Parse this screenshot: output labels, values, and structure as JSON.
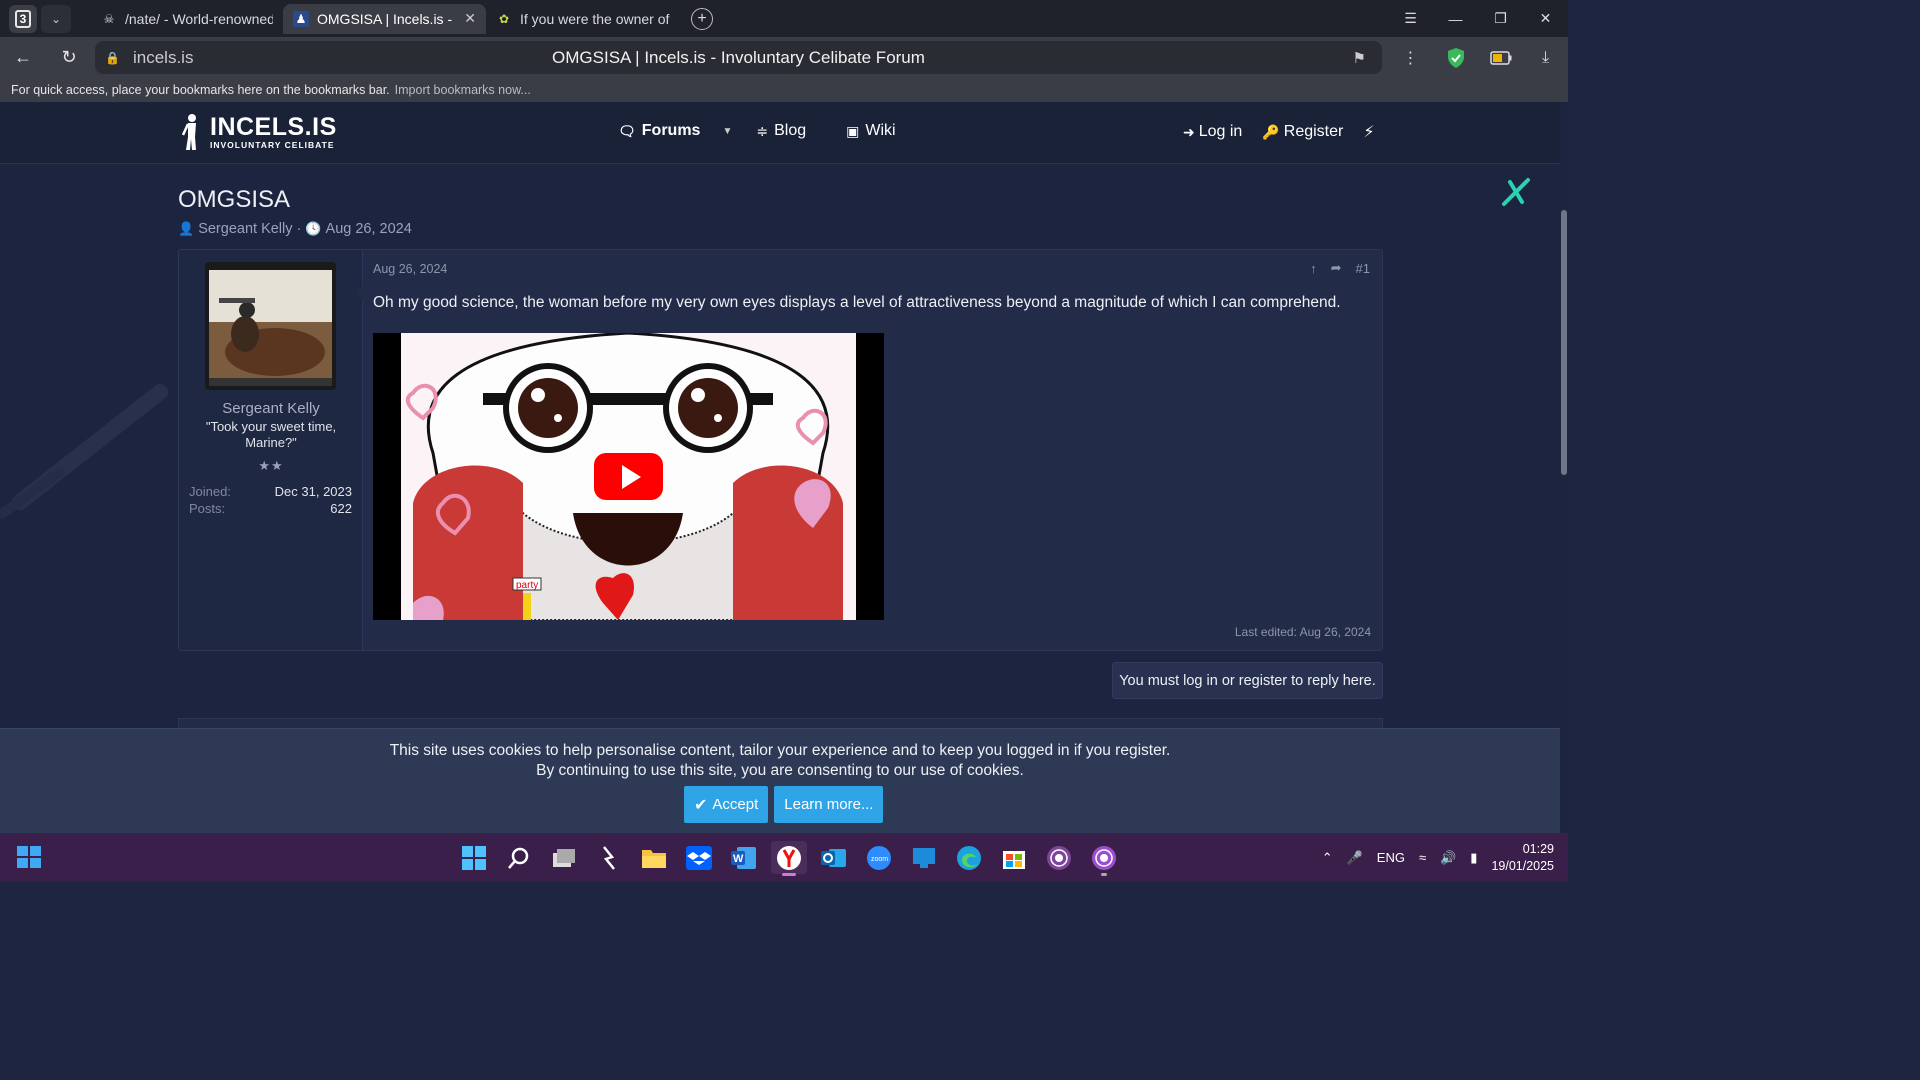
{
  "browser": {
    "tab_count": "3",
    "tabs": [
      {
        "title": "/nate/ - World-renowned C",
        "active": false
      },
      {
        "title": "OMGSISA | Incels.is - Inv",
        "active": true
      },
      {
        "title": "If you were the owner of th",
        "active": false
      }
    ],
    "url_domain": "incels.is",
    "page_title": "OMGSISA | Incels.is - Involuntary Celibate Forum",
    "bookmarks_hint": "For quick access, place your bookmarks here on the bookmarks bar.",
    "bookmarks_import": "Import bookmarks now..."
  },
  "site": {
    "logo_main": "INCELS.IS",
    "logo_sub": "INVOLUNTARY CELIBATE",
    "nav": {
      "forums": "Forums",
      "blog": "Blog",
      "wiki": "Wiki"
    },
    "auth": {
      "login": "Log in",
      "register": "Register"
    }
  },
  "thread": {
    "title": "OMGSISA",
    "author": "Sergeant Kelly",
    "date": "Aug 26, 2024"
  },
  "post": {
    "date": "Aug 26, 2024",
    "number": "#1",
    "text": "Oh my good science, the woman before my very own eyes displays a level of attractiveness beyond a magnitude of which I can comprehend.",
    "last_edited": "Last edited: Aug 26, 2024",
    "video_sticker": "party",
    "user": {
      "name": "Sergeant Kelly",
      "title": "\"Took your sweet time, Marine?\"",
      "stars": "★★",
      "joined_label": "Joined:",
      "joined_value": "Dec 31, 2023",
      "posts_label": "Posts:",
      "posts_value": "622"
    }
  },
  "reply_notice": "You must log in or register to reply here.",
  "cookie": {
    "line1": "This site uses cookies to help personalise content, tailor your experience and to keep you logged in if you register.",
    "line2": "By continuing to use this site, you are consenting to our use of cookies.",
    "accept": "Accept",
    "learn_more": "Learn more..."
  },
  "taskbar": {
    "lang": "ENG",
    "time": "01:29",
    "date": "19/01/2025"
  },
  "colors": {
    "accent": "#2fa4e7",
    "site_bg": "#1c2440",
    "taskbar_bg": "#3a1f4a",
    "youtube_red": "#ff0000"
  }
}
